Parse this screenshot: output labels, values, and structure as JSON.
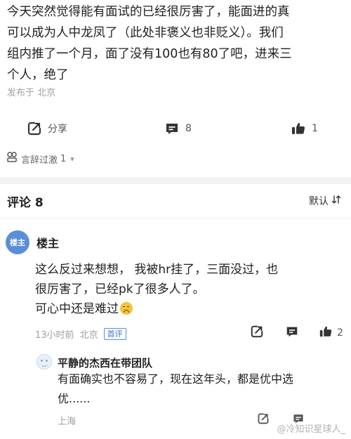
{
  "post": {
    "body_lines": [
      "今天突然觉得能有面试的已经很厉害了，能面进的真",
      "可以成为人中龙凤了（此处非褒义也非贬义）。我们",
      "组内推了一个月，面了没有100也有80了吧，进来三",
      "个人，绝了"
    ],
    "location": "发布于 北京",
    "actions": {
      "share_label": "分享",
      "comment_count": "8",
      "like_count": "1"
    },
    "debate_label": "言辞过激",
    "debate_count": "1"
  },
  "comments_header": {
    "title": "评论 8",
    "sort_label": "默认"
  },
  "comment": {
    "avatar_label": "楼主",
    "author": "楼主",
    "body_lines": [
      "这么反过来想想， 我被hr挂了，三面没过，也",
      "很厉害了，已经pk了很多人了。",
      "可心中还是难过"
    ],
    "time": "13小时前",
    "location": "北京",
    "badge": "首评",
    "like_count": "2"
  },
  "reply": {
    "author": "平静的杰西在带团队",
    "body_lines": [
      "有面确实也不容易了，现在这年头，都是优中选",
      "优......"
    ],
    "location": "上海"
  },
  "watermark": "@冷知识星球人_",
  "colors": {
    "accent_blue": "#5a8fd8",
    "muted_text": "#a0a0a0",
    "separator_band": "#f2f2f2"
  }
}
